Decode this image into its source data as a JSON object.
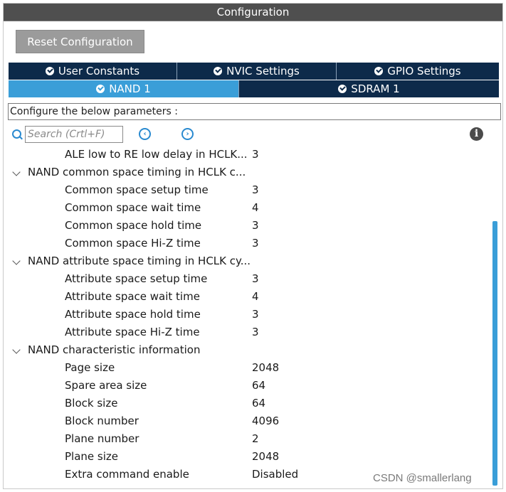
{
  "window": {
    "title": "Configuration"
  },
  "toolbar": {
    "reset_label": "Reset Configuration"
  },
  "tabs_row1": [
    {
      "label": "User Constants",
      "active": false
    },
    {
      "label": "NVIC Settings",
      "active": false
    },
    {
      "label": "GPIO Settings",
      "active": false
    }
  ],
  "tabs_row2": [
    {
      "label": "NAND 1",
      "active": true
    },
    {
      "label": "SDRAM 1",
      "active": false
    }
  ],
  "section": {
    "label": "Configure the below parameters :"
  },
  "search": {
    "placeholder": "Search (Crtl+F)",
    "value": ""
  },
  "tree": {
    "top_item": {
      "name": "ALE low to RE low delay in HCLK...",
      "value": "3"
    },
    "groups": [
      {
        "title": "NAND common space timing in HCLK c...",
        "items": [
          {
            "name": "Common space setup time",
            "value": "3"
          },
          {
            "name": "Common space wait time",
            "value": "4"
          },
          {
            "name": "Common space hold time",
            "value": "3"
          },
          {
            "name": "Common space Hi-Z time",
            "value": "3"
          }
        ]
      },
      {
        "title": "NAND attribute space timing in HCLK cy...",
        "items": [
          {
            "name": "Attribute space setup time",
            "value": "3"
          },
          {
            "name": "Attribute space wait time",
            "value": "4"
          },
          {
            "name": "Attribute space hold time",
            "value": "3"
          },
          {
            "name": "Attribute space Hi-Z time",
            "value": "3"
          }
        ]
      },
      {
        "title": "NAND characteristic information",
        "items": [
          {
            "name": "Page size",
            "value": "2048"
          },
          {
            "name": "Spare area size",
            "value": "64"
          },
          {
            "name": "Block size",
            "value": "64"
          },
          {
            "name": "Block number",
            "value": "4096"
          },
          {
            "name": "Plane number",
            "value": "2"
          },
          {
            "name": "Plane size",
            "value": "2048"
          },
          {
            "name": "Extra command enable",
            "value": "Disabled"
          }
        ]
      }
    ]
  },
  "watermark": "CSDN @smallerlang",
  "colors": {
    "title_bar": "#4f4f4f",
    "tab_dark": "#0d2a4a",
    "tab_active": "#3a9ed8",
    "accent": "#2a8ad0"
  }
}
